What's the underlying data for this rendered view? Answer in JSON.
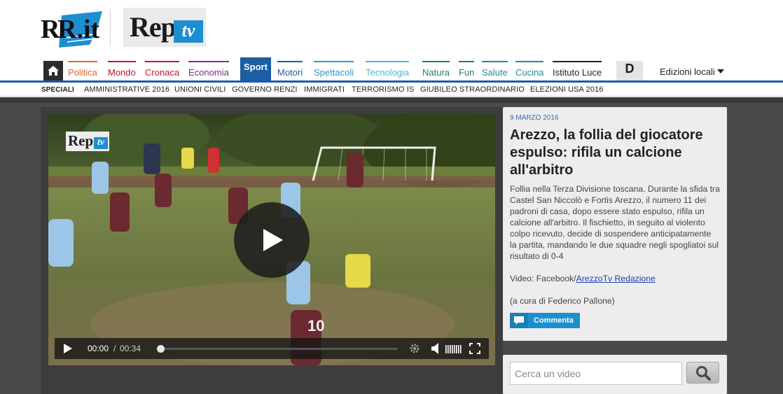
{
  "header": {
    "logo_rit": "R.it",
    "logo_rep": "Rep",
    "logo_tv": "tv"
  },
  "nav": {
    "items": [
      {
        "label": "Politica",
        "color": "#e2652c"
      },
      {
        "label": "Mondo",
        "color": "#c8102e"
      },
      {
        "label": "Cronaca",
        "color": "#c8102e"
      },
      {
        "label": "Economia",
        "color": "#7c2b8a"
      },
      {
        "label": "Sport",
        "color": "#1d5da3"
      },
      {
        "label": "Motori",
        "color": "#1d5da3"
      },
      {
        "label": "Spettacoli",
        "color": "#2a9ad3"
      },
      {
        "label": "Tecnologia",
        "color": "#4fb5dd"
      },
      {
        "label": "Natura",
        "color": "#1f7f6b"
      },
      {
        "label": "Fun",
        "color": "#1f7f6b"
      },
      {
        "label": "Salute",
        "color": "#1f8a9c"
      },
      {
        "label": "Cucina",
        "color": "#1f8a9c"
      },
      {
        "label": "Istituto Luce",
        "color": "#222222"
      },
      {
        "label": "D",
        "color": "#222222"
      }
    ],
    "edizioni": "Edizioni locali"
  },
  "speciali": {
    "label": "SPECIALI",
    "items": [
      "AMMINISTRATIVE 2016",
      "UNIONI CIVILI",
      "GOVERNO RENZI",
      "IMMIGRATI",
      "TERRORISMO IS",
      "GIUBILEO STRAORDINARIO",
      "ELEZIONI USA 2016"
    ]
  },
  "player": {
    "watermark_rep": "Rep",
    "watermark_tv": "tv",
    "current_time": "00:00",
    "separator": "/",
    "duration": "00:34",
    "jersey": "10"
  },
  "article": {
    "date": "9 MARZO 2016",
    "title": "Arezzo, la follia del giocatore espulso: rifila un calcione all'arbitro",
    "body": "Follia nella Terza Divisione toscana. Durante la sfida tra Castel San Niccolò e Fortis Arezzo, il numero 11 dei padroni di casa, dopo essere stato espulso, rifila un calcione all'arbitro. Il fischietto, in seguito al violento colpo ricevuto, decide di sospendere anticipatamente la partita, mandando le due squadre negli spogliatoi sul risultato di 0-4",
    "video_prefix": "Video: Facebook/",
    "video_link": "ArezzoTv Redazione",
    "curator": "(a cura di Federico Pallone)",
    "comment_label": "Commenta"
  },
  "search": {
    "placeholder": "Cerca un video"
  },
  "colors": {
    "nav_blue": "#1d5da3",
    "accent_blue": "#1d8fd0",
    "dark_bg": "#4a4a4a"
  }
}
